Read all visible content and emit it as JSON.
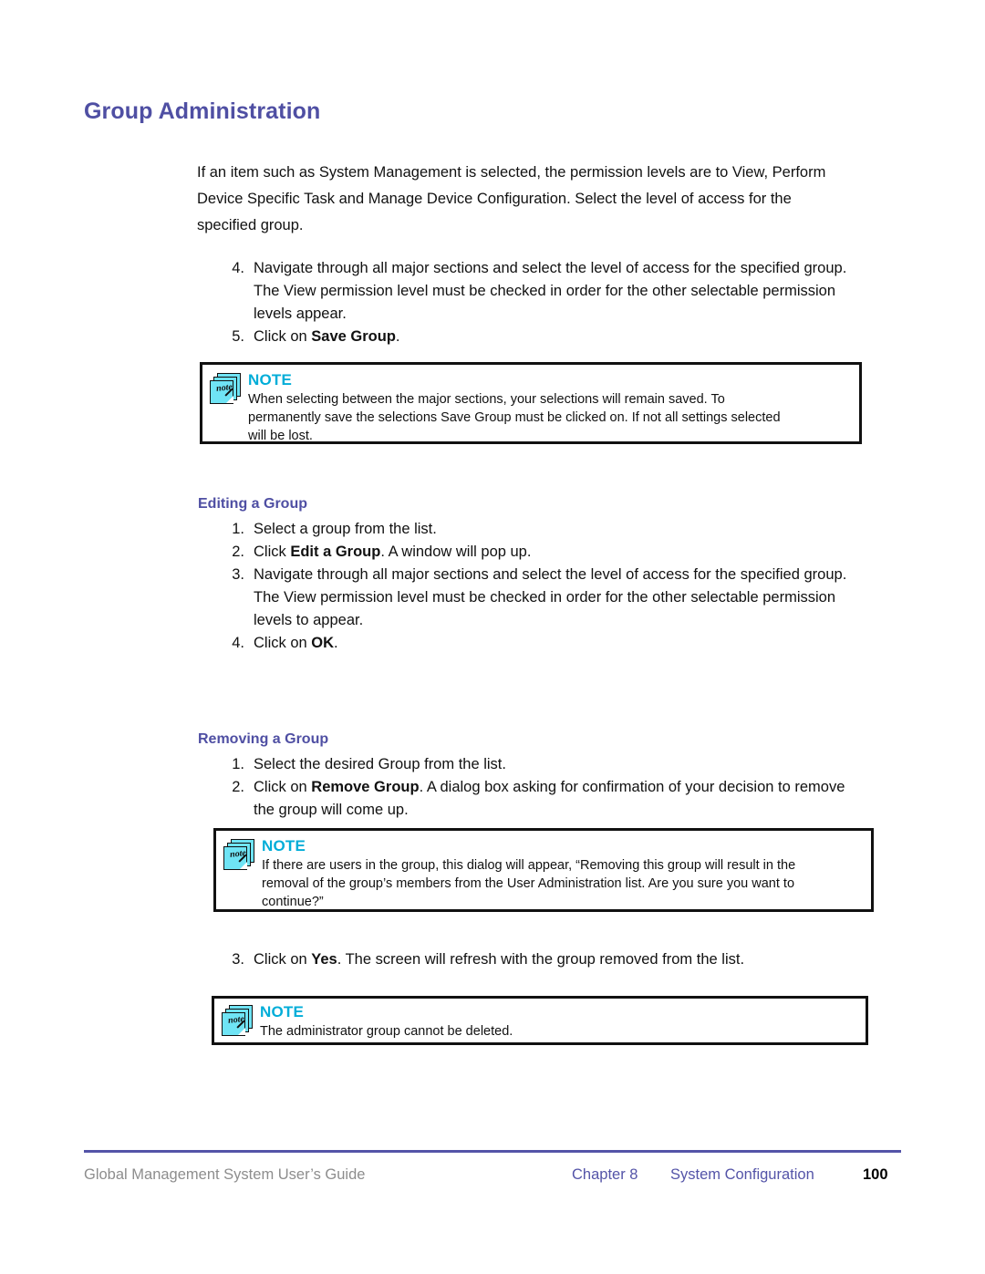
{
  "title": "Group Administration",
  "intro": {
    "lines": [
      "If an item such as System Management is selected, the permission levels are to View, Perform",
      "Device Specific Task and Manage Device Configuration. Select the level of access for the",
      "specified group."
    ]
  },
  "top_list": {
    "items": [
      {
        "num": "4.",
        "lines": [
          "Navigate through all major sections and select the level of access for the specified group.",
          "The View permission level must be checked in order for the other selectable permission",
          "levels appear."
        ]
      },
      {
        "num": "5.",
        "pre": "Click on ",
        "bold": "Save Group",
        "post": "."
      }
    ]
  },
  "note1": {
    "label": "NOTE",
    "icon": "note-stack-icon",
    "lines": [
      "When selecting between the major sections, your selections will remain saved. To",
      "permanently save the selections Save Group must be clicked on. If not all settings selected",
      "will be lost."
    ]
  },
  "editing": {
    "heading": "Editing a Group",
    "items": [
      {
        "num": "1.",
        "pre": "Select a group from the list."
      },
      {
        "num": "2.",
        "pre": "Click ",
        "bold": "Edit a Group",
        "post": ". A window will pop up."
      },
      {
        "num": "3.",
        "lines": [
          "Navigate through all major sections and select the level of access for the specified group.",
          "The View permission level must be checked in order for the other selectable permission",
          "levels to appear."
        ]
      },
      {
        "num": "4.",
        "pre": "Click on ",
        "bold": "OK",
        "post": "."
      }
    ]
  },
  "removing": {
    "heading": "Removing a Group",
    "items": [
      {
        "num": "1.",
        "pre": "Select the desired Group from the list."
      },
      {
        "num": "2.",
        "pre": "Click on ",
        "bold": "Remove Group",
        "post": ". A dialog box asking for confirmation of your decision to remove",
        "line2": "the group will come up."
      }
    ]
  },
  "note2": {
    "label": "NOTE",
    "icon": "note-stack-icon",
    "lines": [
      "If there are users in the group, this dialog will appear, “Removing this group will result in the",
      "removal of the group’s members from the User Administration list. Are you sure you want to",
      "continue?”"
    ]
  },
  "after_note2": {
    "num": "3.",
    "pre": "Click on ",
    "bold": "Yes",
    "post": ". The screen will refresh with the group removed from the list."
  },
  "note3": {
    "label": "NOTE",
    "icon": "note-stack-icon",
    "lines": [
      "The administrator group cannot be deleted."
    ]
  },
  "footer": {
    "left": "Global Management System User’s Guide",
    "chapter": "Chapter 8",
    "section": "System Configuration",
    "page": "100"
  },
  "colors": {
    "heading_purple": "#4f4fa3",
    "note_cyan": "#00add8",
    "note_icon_fill": "#6fe4f5",
    "footer_gray": "#8d8d8d",
    "rule_purple": "#5454a8",
    "body_black": "#111111"
  }
}
